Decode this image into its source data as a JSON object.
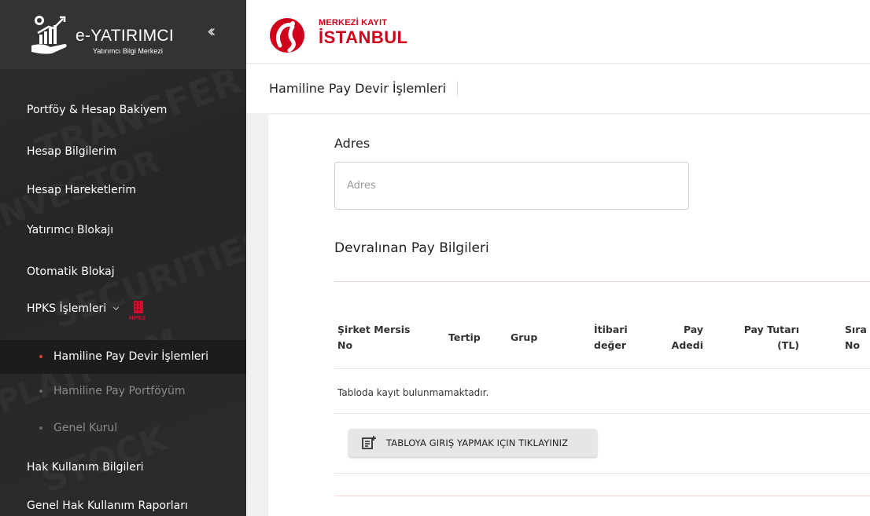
{
  "app": {
    "title": "e-YATIRIMCI",
    "subtitle": "Yatırımcı Bilgi Merkezi",
    "collapse_icon": "double-chevron-left-icon"
  },
  "sidebar": {
    "items": [
      {
        "label": "Portföy & Hesap Bakiyem"
      },
      {
        "label": "Hesap Bilgilerim"
      },
      {
        "label": "Hesap Hareketlerim"
      },
      {
        "label": "Yatırımcı Blokajı"
      },
      {
        "label": "Otomatik Blokaj"
      },
      {
        "label": "HPKS İşlemleri"
      },
      {
        "label": "Hak Kullanım Bilgileri"
      },
      {
        "label": "Genel Hak Kullanım Raporları"
      }
    ],
    "hpks_badge": "HPKS",
    "subitems": [
      {
        "label": "Hamiline Pay Devir İşlemleri",
        "active": true
      },
      {
        "label": "Hamiline Pay Portföyüm",
        "active": false
      },
      {
        "label": "Genel Kurul",
        "active": false
      }
    ]
  },
  "header": {
    "brand_top": "MERKEZİ KAYIT",
    "brand_bottom": "İSTANBUL"
  },
  "breadcrumb": "Hamiline Pay Devir İşlemleri",
  "form": {
    "adres_label": "Adres",
    "adres_placeholder": "Adres",
    "adres_value": ""
  },
  "section": {
    "title": "Devralınan Pay Bilgileri"
  },
  "table": {
    "columns": [
      {
        "line1": "Şirket Mersis",
        "line2": "No"
      },
      {
        "line1": "Tertip",
        "line2": ""
      },
      {
        "line1": "Grup",
        "line2": ""
      },
      {
        "line1": "İtibari",
        "line2": "değer"
      },
      {
        "line1": "Pay",
        "line2": "Adedi"
      },
      {
        "line1": "Pay Tutarı",
        "line2": "(TL)"
      },
      {
        "line1": "Sıra",
        "line2": "No"
      }
    ],
    "empty_message": "Tabloda kayıt bulunmamaktadır.",
    "add_button": "TABLOYA GIRIŞ YAPMAK IÇIN TIKLAYINIZ"
  },
  "colors": {
    "sidebar_bg": "#2b2b2b",
    "active_bg": "#1c1c1c",
    "accent_red": "#d0021b",
    "active_dot": "#e23a2c"
  }
}
